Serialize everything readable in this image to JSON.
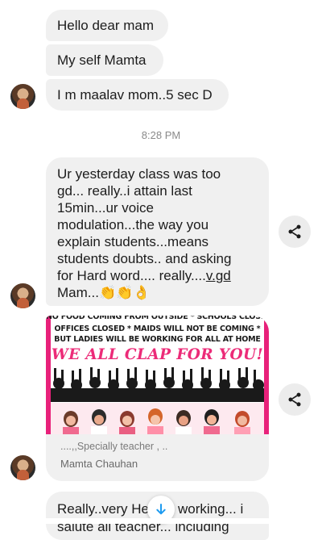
{
  "messages": [
    {
      "text": "Hello dear mam"
    },
    {
      "text": "My self Mamta"
    },
    {
      "text": "I m maalav mom..5 sec D"
    }
  ],
  "timestamp": "8:28 PM",
  "long_message": {
    "text": "Ur yesterday class was too\ngd... really..i attain last\n15min...ur voice\nmodulation...the way you\nexplain students...means\nstudents doubts.. and asking\nfor Hard word.... really....",
    "underlined": "v.gd",
    "after_underline": "\nMam...",
    "emoji": "👏👏👌"
  },
  "shared_post": {
    "poster_line1": "NO FOOD COMING FROM OUTSIDE * SCHOOLS CLOSED",
    "poster_line2": "OFFICES CLOSED * MAIDS WILL NOT BE COMING *",
    "poster_line3": "BUT LADIES WILL BE WORKING FOR ALL AT HOME",
    "poster_headline": "WE ALL CLAP FOR YOU!",
    "caption": "....,,Specially teacher , ..",
    "author": "Mamta Chauhan"
  },
  "last_message": {
    "line1_part1": "Really..very He",
    "line1_part2": "working... i",
    "line2": "salute all teacher... including"
  },
  "icons": {
    "share": "share-icon",
    "scroll": "arrow-down-icon",
    "avatar": "avatar"
  },
  "colors": {
    "bubble": "#f0f0f0",
    "accent_pink": "#ec2b78",
    "scroll_arrow": "#1d9bf0"
  }
}
